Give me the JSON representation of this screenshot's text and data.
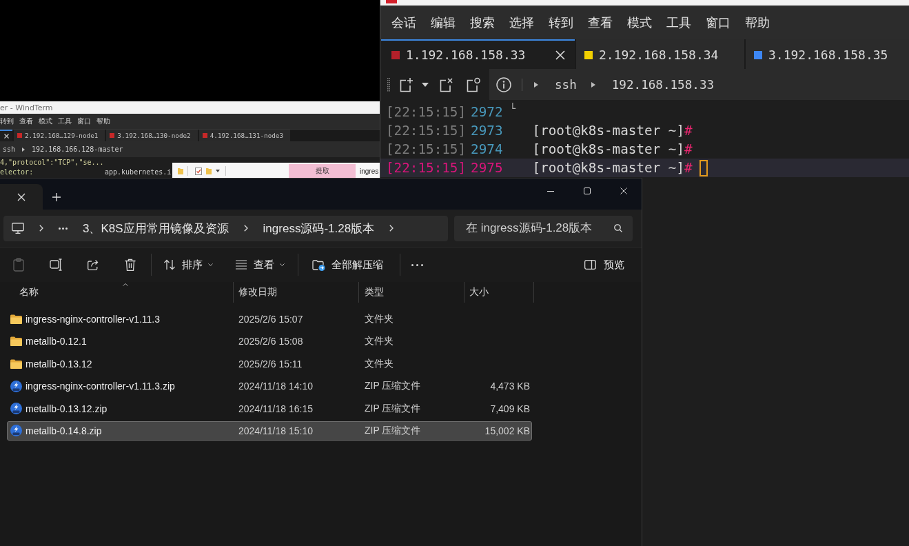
{
  "back_window": {
    "title": "er - WindTerm",
    "menu": [
      "转到",
      "查看",
      "模式",
      "工具",
      "窗口",
      "帮助"
    ],
    "tabs": [
      {
        "selected": true
      },
      {
        "label": "2.192.168…129-node1",
        "color": "#c62828",
        "selected": false
      },
      {
        "label": "3.192.168…130-node2",
        "color": "#c62828",
        "selected": false
      },
      {
        "label": "4.192.168…131-node3",
        "color": "#c62828",
        "selected": false
      }
    ],
    "path": [
      "ssh",
      "192.168.166.128-master"
    ],
    "lines": [
      [
        {
          "text": "4,\"protocol\":\"TCP\",\"se...",
          "kind": "string"
        }
      ],
      [
        {
          "text": "elector:",
          "kind": "key"
        },
        {
          "text": "app.kubernetes.i",
          "kind": "value"
        }
      ]
    ]
  },
  "extract_bar": {
    "button": "提取",
    "label": "ingres"
  },
  "terminal": {
    "menu": [
      "会话",
      "编辑",
      "搜索",
      "选择",
      "转到",
      "查看",
      "模式",
      "工具",
      "窗口",
      "帮助"
    ],
    "tabs": [
      {
        "label": "1.192.168.158.33",
        "color": "#b3202a",
        "selected": true
      },
      {
        "label": "2.192.168.158.34",
        "color": "#f2d000",
        "selected": false
      },
      {
        "label": "3.192.168.158.35",
        "color": "#3d87f5",
        "selected": false
      }
    ],
    "path": [
      "ssh",
      "192.168.158.33"
    ],
    "lines": [
      {
        "time": "[22:15:15]",
        "number": "2972",
        "marker": "└",
        "current": false
      },
      {
        "time": "[22:15:15]",
        "number": "2973",
        "prompt": "[root@k8s-master ~]",
        "symbol": "#",
        "current": false
      },
      {
        "time": "[22:15:15]",
        "number": "2974",
        "prompt": "[root@k8s-master ~]",
        "symbol": "#",
        "current": false
      },
      {
        "time": "[22:15:15]",
        "number": "2975",
        "prompt": "[root@k8s-master ~]",
        "symbol": "#",
        "current": true
      }
    ]
  },
  "explorer": {
    "breadcrumb": [
      "3、K8S应用常用镜像及资源",
      "ingress源码-1.28版本"
    ],
    "search": {
      "placeholder": "在 ingress源码-1.28版本"
    },
    "toolbar": {
      "actions": [
        {
          "kind": "paste",
          "disabled": true
        },
        {
          "kind": "rename",
          "disabled": false
        },
        {
          "kind": "share",
          "disabled": false
        },
        {
          "kind": "delete",
          "disabled": false
        }
      ],
      "sort": "排序",
      "view": "查看",
      "extract": "全部解压缩",
      "preview": "预览"
    },
    "columns": [
      {
        "label": "名称",
        "sorted": true
      },
      {
        "label": "修改日期",
        "sorted": false
      },
      {
        "label": "类型",
        "sorted": false
      },
      {
        "label": "大小",
        "sorted": false
      }
    ],
    "files": [
      {
        "kind": "folder",
        "name": "ingress-nginx-controller-v1.11.3",
        "date": "2025/2/6 15:07",
        "type": "文件夹",
        "selected": false
      },
      {
        "kind": "folder",
        "name": "metallb-0.12.1",
        "date": "2025/2/6 15:08",
        "type": "文件夹",
        "selected": false
      },
      {
        "kind": "folder",
        "name": "metallb-0.13.12",
        "date": "2025/2/6 15:11",
        "type": "文件夹",
        "selected": false
      },
      {
        "kind": "zip",
        "name": "ingress-nginx-controller-v1.11.3.zip",
        "date": "2024/11/18 14:10",
        "type": "ZIP 压缩文件",
        "size": "4,473 KB",
        "selected": false
      },
      {
        "kind": "zip",
        "name": "metallb-0.13.12.zip",
        "date": "2024/11/18 16:15",
        "type": "ZIP 压缩文件",
        "size": "7,409 KB",
        "selected": false
      },
      {
        "kind": "zip",
        "name": "metallb-0.14.8.zip",
        "date": "2024/11/18 15:10",
        "type": "ZIP 压缩文件",
        "size": "15,002 KB",
        "selected": true
      }
    ]
  }
}
